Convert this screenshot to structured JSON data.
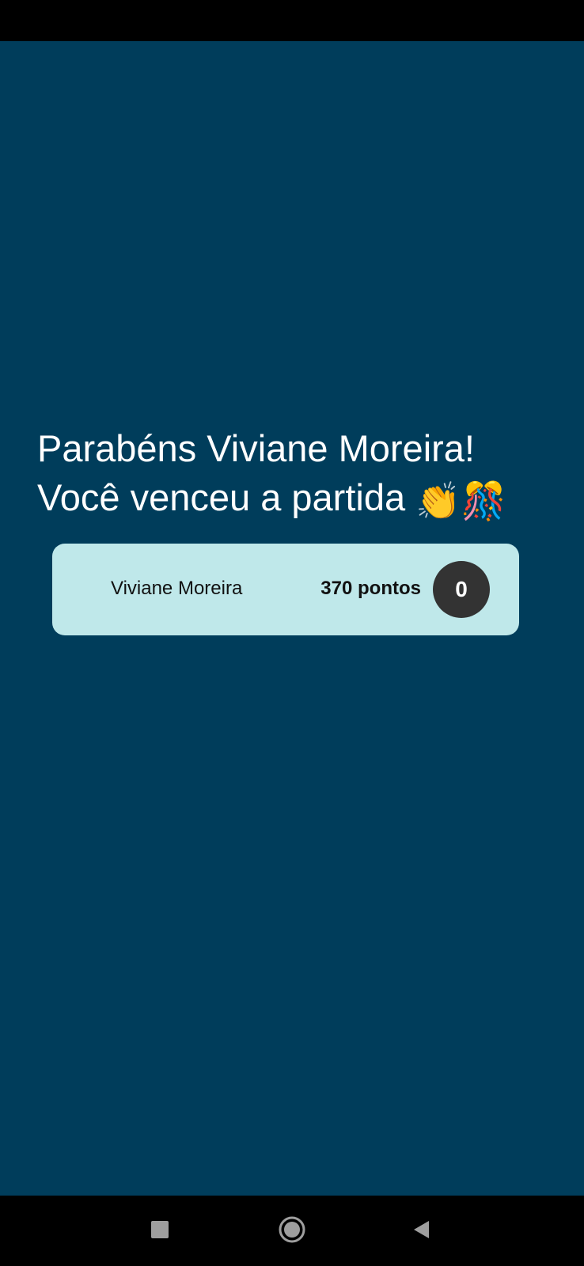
{
  "result": {
    "line1": "Parabéns Viviane Moreira!",
    "line2": "Você venceu a partida",
    "emojis": "👏🎊"
  },
  "scoreboard": {
    "player": {
      "name": "Viviane Moreira",
      "points": "370 pontos",
      "badge": "0"
    }
  },
  "navigation": {
    "recents_icon": "square-icon",
    "home_icon": "circle-icon",
    "back_icon": "triangle-back-icon"
  },
  "colors": {
    "background": "#003d5b",
    "card": "#bfe8ea",
    "badge": "#333333",
    "system_bars": "#000000"
  }
}
